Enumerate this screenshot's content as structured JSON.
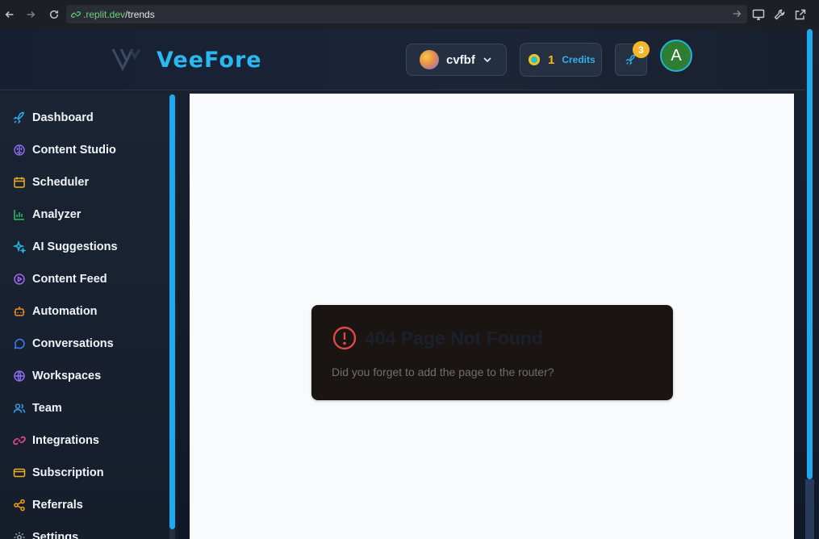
{
  "browser": {
    "url_host": ".replit.dev",
    "url_path": "/trends"
  },
  "header": {
    "brand": "VeeFore",
    "workspace_name": "cvfbf",
    "credits_count": "1",
    "credits_label": "Credits",
    "notification_count": "3",
    "user_initial": "A"
  },
  "colors": {
    "accent": "#2bb8f0",
    "credits_number": "#f6b91a",
    "badge": "#f4b62a",
    "avatar_bg": "#2e7d32",
    "error": "#e04848"
  },
  "sidebar": {
    "items": [
      {
        "label": "Dashboard",
        "icon": "rocket-icon",
        "color": "#2fb3ea"
      },
      {
        "label": "Content Studio",
        "icon": "brain-icon",
        "color": "#8b6cf0"
      },
      {
        "label": "Scheduler",
        "icon": "calendar-icon",
        "color": "#f2b01e"
      },
      {
        "label": "Analyzer",
        "icon": "bar-chart-icon",
        "color": "#22c55e"
      },
      {
        "label": "AI Suggestions",
        "icon": "sparkles-icon",
        "color": "#22b8e6"
      },
      {
        "label": "Content Feed",
        "icon": "play-circle-icon",
        "color": "#a068f0"
      },
      {
        "label": "Automation",
        "icon": "bot-icon",
        "color": "#f08a24"
      },
      {
        "label": "Conversations",
        "icon": "message-circle-icon",
        "color": "#3b82f6"
      },
      {
        "label": "Workspaces",
        "icon": "globe-icon",
        "color": "#8b6cf0"
      },
      {
        "label": "Team",
        "icon": "users-icon",
        "color": "#3b9cf0"
      },
      {
        "label": "Integrations",
        "icon": "link-icon",
        "color": "#ec4899"
      },
      {
        "label": "Subscription",
        "icon": "credit-card-icon",
        "color": "#f2b01e"
      },
      {
        "label": "Referrals",
        "icon": "share-icon",
        "color": "#f59e0b"
      },
      {
        "label": "Settings",
        "icon": "gear-icon",
        "color": "#9ca3af"
      }
    ]
  },
  "main": {
    "error_title": "404 Page Not Found",
    "error_message": "Did you forget to add the page to the router?"
  }
}
